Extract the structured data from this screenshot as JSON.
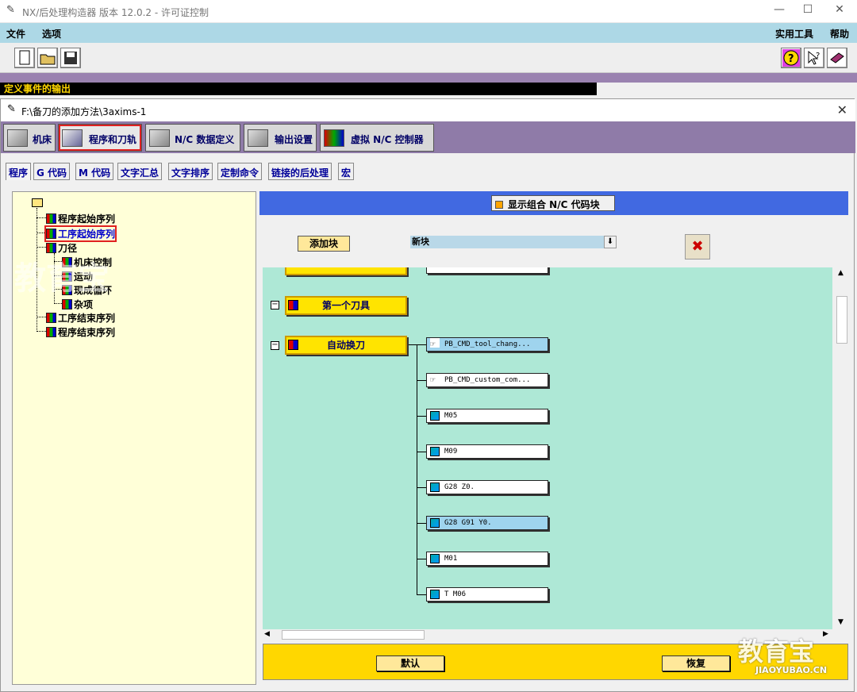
{
  "app": {
    "title": "NX/后处理构造器 版本 12.0.2 - 许可证控制",
    "minimize": "—",
    "maximize": "☐",
    "close": "✕"
  },
  "menu": {
    "file": "文件",
    "options": "选项",
    "utilities": "实用工具",
    "help": "帮助"
  },
  "status": "定义事件的输出",
  "inner": {
    "title": "F:\\备刀的添加方法\\3axims-1",
    "close": "✕"
  },
  "main_tabs": [
    "机床",
    "程序和刀轨",
    "N/C 数据定义",
    "输出设置",
    "虚拟 N/C 控制器"
  ],
  "sub_tabs": [
    "程序",
    "G 代码",
    "M 代码",
    "文字汇总",
    "文字排序",
    "定制命令",
    "链接的后处理",
    "宏"
  ],
  "tree": {
    "items": [
      "程序起始序列",
      "工序起始序列",
      "刀径",
      "机床控制",
      "运动",
      "现成循环",
      "杂项",
      "工序结束序列",
      "程序结束序列"
    ]
  },
  "right": {
    "show_combined": "显示组合 N/C 代码块",
    "add_block": "添加块",
    "new_block": "新块",
    "drop": "⬇"
  },
  "events": [
    "第一个刀具",
    "自动换刀"
  ],
  "blocks": [
    "PB_CMD_tool_chang...",
    "PB_CMD_custom_com...",
    "M05",
    "M09",
    "G28 Z0.",
    "G28 G91 Y0.",
    "M01",
    "T M06"
  ],
  "bottom": {
    "default": "默认",
    "restore": "恢复"
  },
  "watermark": {
    "main": "教育宝",
    "sub": "JIAOYUBAO.CN"
  }
}
